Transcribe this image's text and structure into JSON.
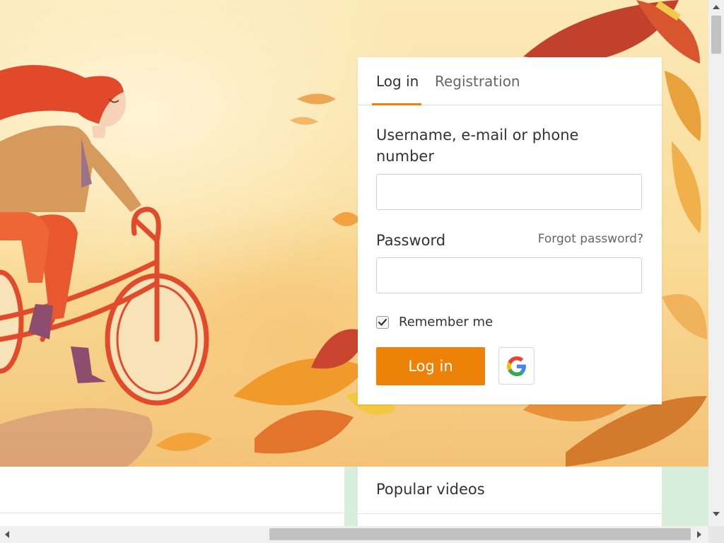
{
  "colors": {
    "accent": "#ee8208",
    "tab_underline": "#ee8208",
    "text_primary": "#333333",
    "text_secondary": "#666666"
  },
  "hero": {
    "illustration": "woman-riding-bicycle-autumn-leaves"
  },
  "login_card": {
    "tabs": [
      {
        "label": "Log in",
        "active": true
      },
      {
        "label": "Registration",
        "active": false
      }
    ],
    "username_label": "Username, e-mail or phone number",
    "username_value": "",
    "password_label": "Password",
    "password_value": "",
    "forgot_label": "Forgot password?",
    "remember_label": "Remember me",
    "remember_checked": true,
    "login_button": "Log in",
    "google_icon": "google-icon"
  },
  "videos": {
    "title": "Popular videos"
  }
}
